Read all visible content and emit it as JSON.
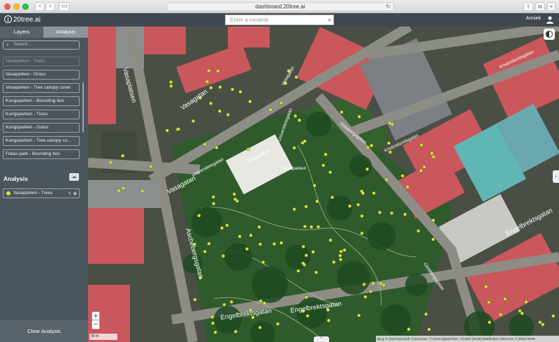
{
  "browser": {
    "url": "dashboard.20tree.ai"
  },
  "app": {
    "logo_text": "20tree.ai",
    "location_placeholder": "Enter a location",
    "user_name": "Anniek"
  },
  "sidebar": {
    "tabs": [
      {
        "label": "Layers"
      },
      {
        "label": "Analysis"
      }
    ],
    "search_placeholder": "Search...",
    "layers": [
      {
        "label": "Vasaparken - Trees",
        "muted": true
      },
      {
        "label": "Vasaparken - Grass"
      },
      {
        "label": "Vasaparken - Tree canopy cover"
      },
      {
        "label": "Kungsparken - Bounding box"
      },
      {
        "label": "Kungsparken - Trees"
      },
      {
        "label": "Kungsparken - Grass"
      },
      {
        "label": "Kungsparken - Tree canopy co..."
      },
      {
        "label": "Flatas park - Bounding box"
      }
    ],
    "analysis_title": "Analysis",
    "analysis_items": [
      {
        "label": "Vasaparken - Trees",
        "color": "#d7e33b"
      }
    ],
    "clear_label": "Clear Analysis"
  },
  "map": {
    "street_labels": [
      {
        "text": "Vasaplatsen"
      },
      {
        "text": "Vasagatan"
      },
      {
        "text": "Vasagatan"
      },
      {
        "text": "Vasagatan"
      },
      {
        "text": "Universitetsgatan"
      },
      {
        "text": "Universitetsgatan"
      },
      {
        "text": "Götabergsgatan"
      },
      {
        "text": "Kristinelundsgatan"
      },
      {
        "text": "Kristinelundsgatan"
      },
      {
        "text": "Engelbrektsgatan"
      },
      {
        "text": "Engelbrektsgatan"
      },
      {
        "text": "Engelbrektsgatan"
      },
      {
        "text": "Aschebergsgatan"
      },
      {
        "text": "Vasaparken"
      },
      {
        "text": "Vasaparken"
      },
      {
        "text": "Götabergsgatan"
      }
    ],
    "attribution": "Bing, © 2019 Microsoft Corporation, © 2019 DigitalGlobe, ©CNES (2019) Distribution Airbus DS, © 2019 HERE",
    "scale_text": "30 m",
    "colors": {
      "tree_dot": "#d7e33b",
      "roof_red": "#c9575b",
      "roof_teal": "#5fb6b4",
      "park": "#2e5a2c",
      "road": "#8d8d85"
    }
  }
}
